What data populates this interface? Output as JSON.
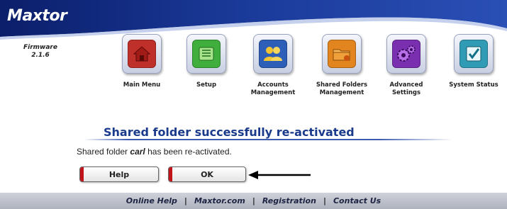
{
  "header": {
    "logo_text": "Maxtor"
  },
  "firmware": {
    "label": "Firmware",
    "version": "2.1.6"
  },
  "nav": {
    "items": [
      {
        "label": "Main Menu",
        "icon": "house-icon",
        "color": "#c0302a"
      },
      {
        "label": "Setup",
        "icon": "setup-icon",
        "color": "#3fae3c"
      },
      {
        "label": "Accounts Management",
        "icon": "users-icon",
        "color": "#2e5fb8"
      },
      {
        "label": "Shared Folders Management",
        "icon": "folder-icon",
        "color": "#e2851f"
      },
      {
        "label": "Advanced Settings",
        "icon": "gears-icon",
        "color": "#7a2fb0"
      },
      {
        "label": "System Status",
        "icon": "checkmark-icon",
        "color": "#2f9bb5"
      }
    ]
  },
  "content": {
    "title": "Shared folder successfully re-activated",
    "message_prefix": "Shared folder",
    "folder_name": "carl",
    "message_suffix": "has been re-activated."
  },
  "buttons": {
    "help_label": "Help",
    "ok_label": "OK"
  },
  "footer": {
    "links": [
      "Online Help",
      "Maxtor.com",
      "Registration",
      "Contact Us"
    ],
    "separator": "|"
  },
  "colors": {
    "brand_blue": "#1a3b8c",
    "accent_red": "#c0141a"
  }
}
